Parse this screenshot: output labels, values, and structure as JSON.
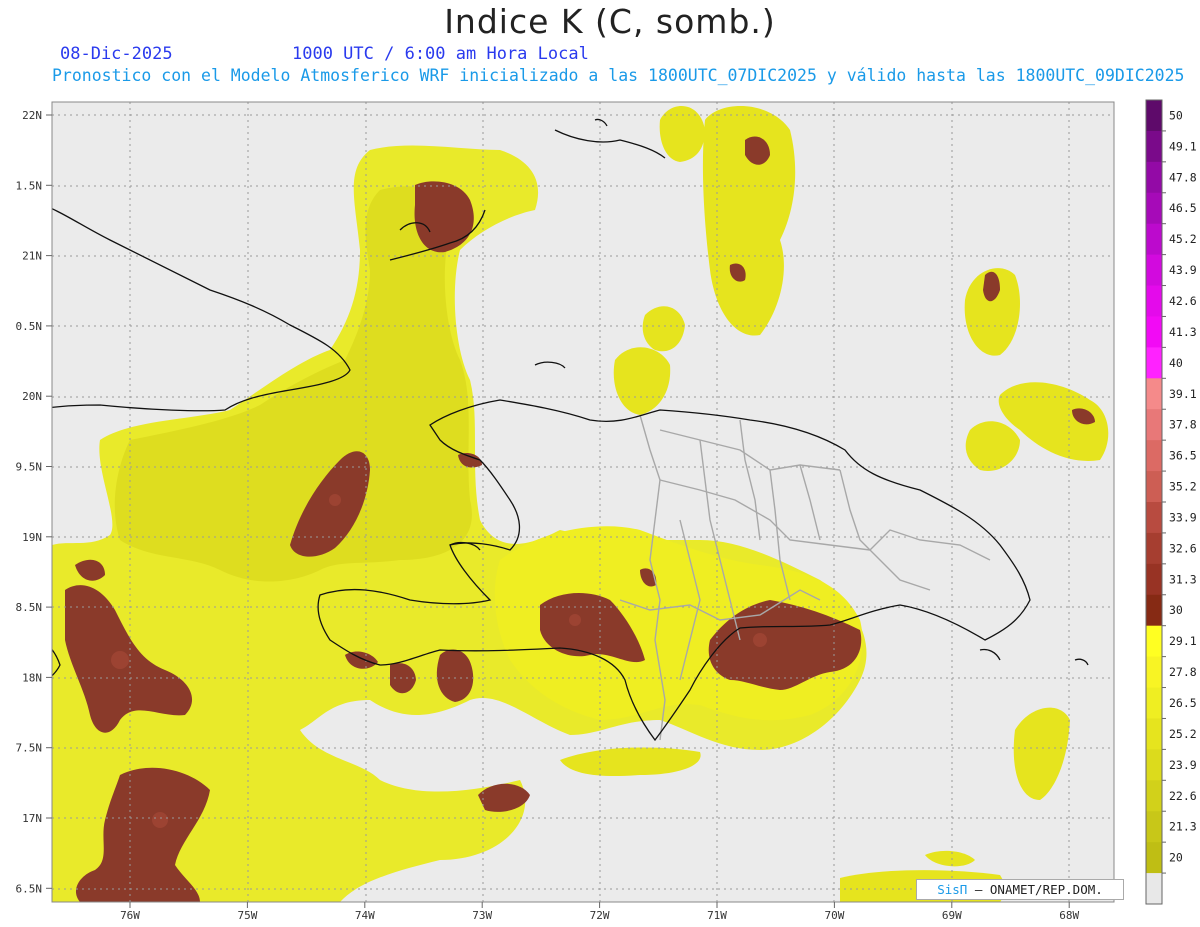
{
  "title": "Indice K (C, somb.)",
  "date": "08-Dic-2025",
  "valid_time": "1000 UTC / 6:00 am Hora Local",
  "description": "Pronostico con el Modelo Atmosferico WRF inicializado a las 1800UTC_07DIC2025 y válido hasta las  1800UTC_09DIC2025",
  "lat_labels": [
    "22N",
    "1.5N",
    "21N",
    "0.5N",
    "20N",
    "9.5N",
    "19N",
    "8.5N",
    "18N",
    "7.5N",
    "17N",
    "6.5N"
  ],
  "lon_labels": [
    "76W",
    "75W",
    "74W",
    "73W",
    "72W",
    "71W",
    "70W",
    "69W",
    "68W"
  ],
  "colorbar_labels": [
    "50",
    "49.1",
    "47.8",
    "46.5",
    "45.2",
    "43.9",
    "42.6",
    "41.3",
    "40",
    "39.1",
    "37.8",
    "36.5",
    "35.2",
    "33.9",
    "32.6",
    "31.3",
    "30",
    "29.1",
    "27.8",
    "26.5",
    "25.2",
    "23.9",
    "22.6",
    "21.3",
    "20"
  ],
  "colorbar_colors": [
    "#5e0a6a",
    "#7a0a8a",
    "#930aa6",
    "#a60ab8",
    "#bc0acd",
    "#d20ade",
    "#e40aeb",
    "#f20af5",
    "#ff22ff",
    "#f58a8a",
    "#e87878",
    "#dc6a64",
    "#cd5e54",
    "#b84b40",
    "#a63e30",
    "#983324",
    "#862a14",
    "#ffff22",
    "#f8f424",
    "#efee22",
    "#e6e41e",
    "#dcdb1c",
    "#d2d11a",
    "#c8c718",
    "#bfbe14",
    "#e8e8e8"
  ],
  "credit": {
    "brand": "SisΠ",
    "text": "– ONAMET/REP.DOM."
  }
}
